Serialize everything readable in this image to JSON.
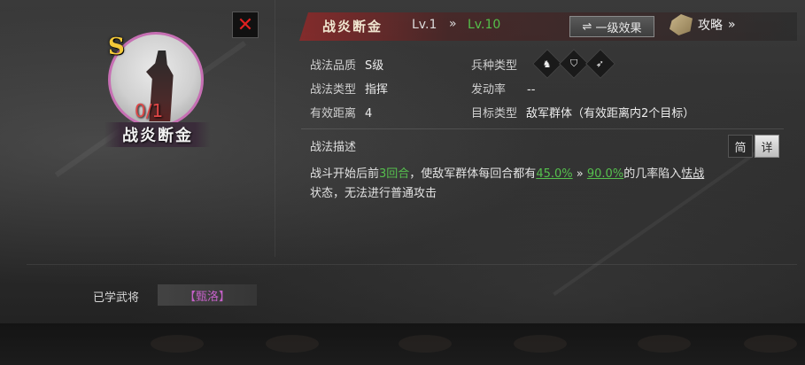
{
  "close": {
    "label": "✕"
  },
  "general": {
    "grade": "S",
    "count": "0/1",
    "name": "战炎断金"
  },
  "header": {
    "skill_name": "战炎断金",
    "level_current": "Lv.1",
    "level_arrow": "»",
    "level_max": "Lv.10",
    "effect_button": "一级效果",
    "effect_icon": "⇌",
    "guide_label": "攻略",
    "guide_arrow": "»"
  },
  "attributes": {
    "quality_label": "战法品质",
    "quality_value": "S级",
    "type_label": "战法类型",
    "type_value": "指挥",
    "range_label": "有效距离",
    "range_value": "4",
    "unit_label": "兵种类型",
    "rate_label": "发动率",
    "rate_value": "--",
    "target_label": "目标类型",
    "target_value": "敌军群体（有效距离内2个目标）",
    "unit_icons": [
      "cavalry-icon",
      "shield-icon",
      "bow-icon"
    ]
  },
  "description": {
    "title": "战法描述",
    "toggle_simple": "简",
    "toggle_detail": "详",
    "t1": "战斗开始后前",
    "rounds": "3回合",
    "t2": "，使敌军群体每回合都有",
    "rate_from": "45.0%",
    "arrow": "»",
    "rate_to": "90.0%",
    "t3": "的几率陷入",
    "status": "怯战",
    "t4": "状态，无法进行普通攻击"
  },
  "learned": {
    "label": "已学武将",
    "general": "【甄洛】"
  },
  "colors": {
    "accent_green": "#56c04e",
    "accent_red": "#e02020",
    "purple": "#c561c8",
    "gold": "#f3c838"
  }
}
